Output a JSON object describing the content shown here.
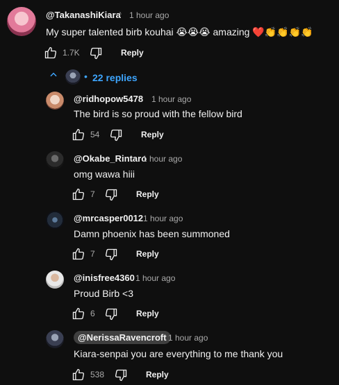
{
  "main_comment": {
    "handle": "@TakanashiKiara",
    "time": "1 hour ago",
    "text": "My super talented birb kouhai 😭😭😭 amazing ❤️👏👏👏👏",
    "likes": "1.7K",
    "reply_label": "Reply"
  },
  "replies_toggle": {
    "label": "22 replies",
    "chevron_icon": "chevron-up-icon"
  },
  "replies": [
    {
      "handle": "@ridhopow5478",
      "time": "1 hour ago",
      "text": "The bird is so proud with the fellow bird",
      "likes": "54",
      "reply_label": "Reply"
    },
    {
      "handle": "@Okabe_Rintaro",
      "time": "1 hour ago",
      "text": "omg wawa hiii",
      "likes": "7",
      "reply_label": "Reply"
    },
    {
      "handle": "@mrcasper0012",
      "time": "1 hour ago",
      "text": "Damn phoenix has been summoned",
      "likes": "7",
      "reply_label": "Reply"
    },
    {
      "handle": "@inisfree4360",
      "time": "1 hour ago",
      "text": "Proud Birb <3",
      "likes": "6",
      "reply_label": "Reply"
    },
    {
      "handle": "@NerissaRavencroft",
      "time": "1 hour ago",
      "text": "Kiara-senpai you are everything to me thank you",
      "likes": "538",
      "reply_label": "Reply"
    }
  ],
  "colors": {
    "background": "#0f0f0f",
    "text": "#f1f1f1",
    "secondary_text": "#aaaaaa",
    "link_blue": "#3ea6ff",
    "handle_pill": "#3f3f3f"
  }
}
